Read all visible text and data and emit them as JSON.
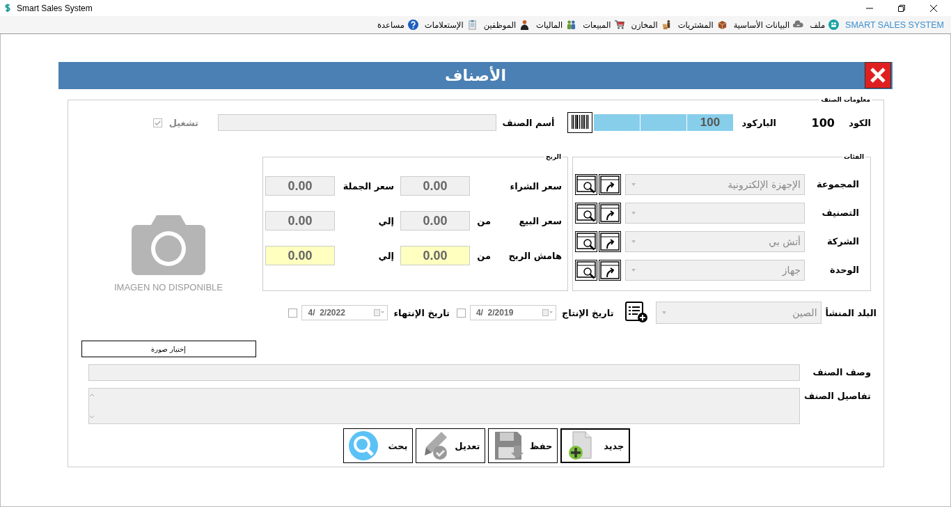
{
  "window": {
    "title": "Smart Sales System"
  },
  "menu": {
    "brand": "SMART SALES SYSTEM",
    "items": [
      "ملف",
      "البيانات الأساسية",
      "المشتريات",
      "المخازن",
      "المبيعات",
      "الماليات",
      "الموظفين",
      "الإستعلامات",
      "مساعدة"
    ]
  },
  "form": {
    "title": "الأصناف"
  },
  "item_info": {
    "legend": "معلومات الصنف",
    "code_label": "الكود",
    "code": "100",
    "barcode_label": "الباركود",
    "barcode": "100",
    "name_label": "أسم الصنف",
    "active_label": "تشغيل",
    "active_checked": true,
    "active_disabled": true
  },
  "categories": {
    "legend": "الفئات",
    "rows": [
      {
        "label": "المجموعة",
        "value": "الإجهزة الإلكترونية"
      },
      {
        "label": "التصنيف",
        "value": ""
      },
      {
        "label": "الشركة",
        "value": "أتش بي"
      },
      {
        "label": "الوحدة",
        "value": "جهاز"
      }
    ]
  },
  "profit": {
    "legend": "الربح",
    "rows": [
      {
        "label": "سعر الشراء",
        "value": "0.00",
        "label2": "سعر الجملة",
        "value2": "0.00",
        "highlight": false
      },
      {
        "label": "سعر البيع",
        "from_label": "من",
        "value": "0.00",
        "label2": "إلي",
        "value2": "0.00",
        "highlight": false
      },
      {
        "label": "هامش الربح",
        "from_label": "من",
        "value": "0.00",
        "label2": "إلي",
        "value2": "0.00",
        "highlight": true
      }
    ]
  },
  "image": {
    "caption": "IMAGEN NO DISPONIBLE",
    "choose_button": "إختيار صورة"
  },
  "origin": {
    "label": "البلد المنشأ",
    "value": "الصين"
  },
  "dates": [
    {
      "label": "تاريخ الإنتاج",
      "value": "4/  2/2019",
      "checked": false
    },
    {
      "label": "تاريخ الإنتهاء",
      "value": "4/  2/2022",
      "checked": false
    }
  ],
  "description": {
    "label": "وصف الصنف"
  },
  "details": {
    "label": "تفاصيل الصنف"
  },
  "buttons": [
    {
      "label": "جديد",
      "selected": true
    },
    {
      "label": "حفظ",
      "selected": false
    },
    {
      "label": "تعديل",
      "selected": false
    },
    {
      "label": "بحث",
      "selected": false
    }
  ]
}
